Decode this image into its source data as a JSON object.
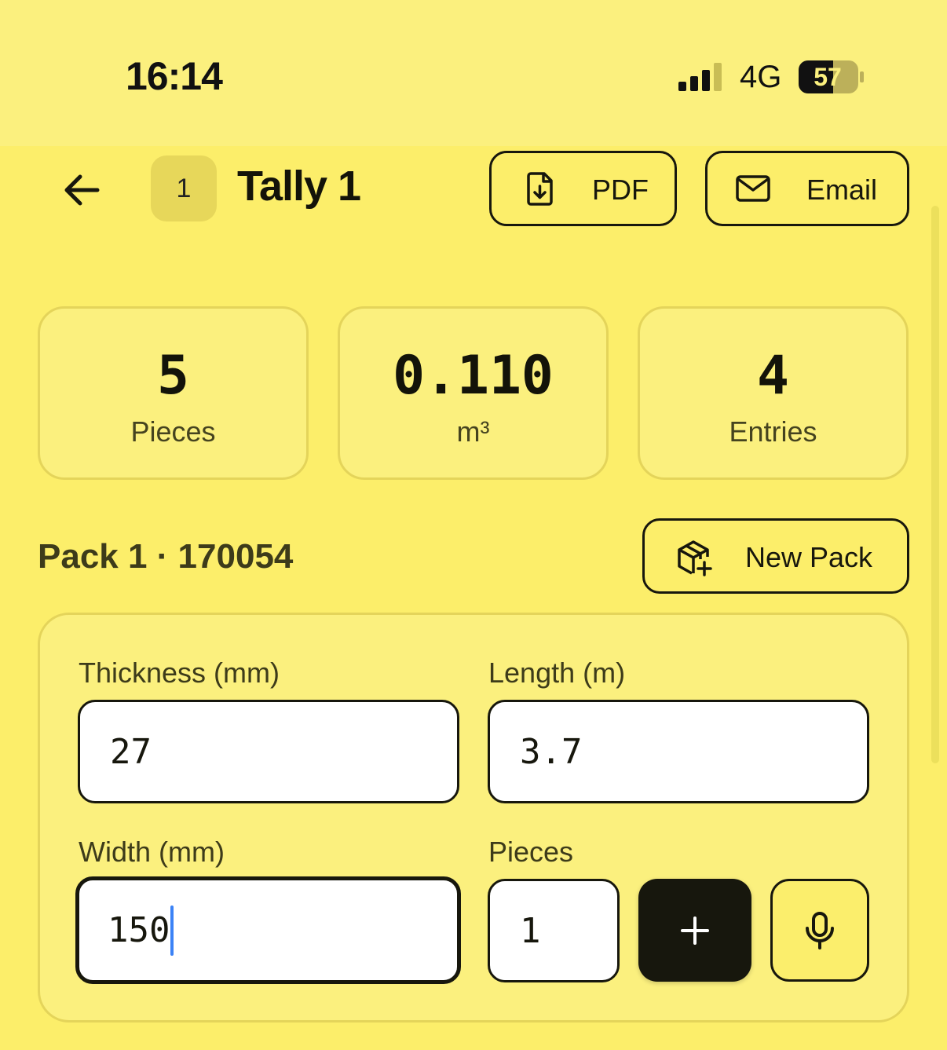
{
  "status_bar": {
    "time": "16:14",
    "network": "4G",
    "battery": "57"
  },
  "header": {
    "badge": "1",
    "title": "Tally 1",
    "pdf_label": "PDF",
    "email_label": "Email"
  },
  "stats": [
    {
      "value": "5",
      "label": "Pieces"
    },
    {
      "value": "0.110",
      "label": "m³"
    },
    {
      "value": "4",
      "label": "Entries"
    }
  ],
  "pack": {
    "title": "Pack 1 · 170054",
    "new_pack_label": "New Pack"
  },
  "form": {
    "thickness": {
      "label": "Thickness (mm)",
      "value": "27"
    },
    "length": {
      "label": "Length (m)",
      "value": "3.7"
    },
    "width": {
      "label": "Width (mm)",
      "value": "150"
    },
    "pieces": {
      "label": "Pieces",
      "value": "1"
    }
  },
  "icons": {
    "back": "arrow-left-icon",
    "pdf": "file-download-icon",
    "email": "mail-icon",
    "new_pack": "package-plus-icon",
    "add": "plus-icon",
    "mic": "microphone-icon"
  },
  "colors": {
    "background": "#fcee6a",
    "card": "#fbf07e",
    "border": "#e4d45a",
    "ink": "#17170d",
    "caret": "#3b82f6"
  }
}
